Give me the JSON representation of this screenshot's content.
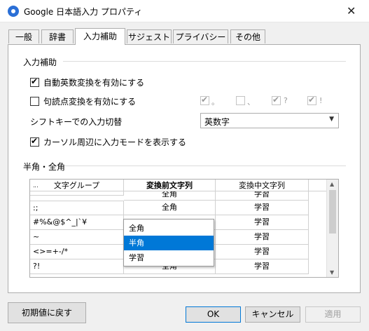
{
  "window": {
    "title": "Google 日本語入力 プロパティ",
    "close_glyph": "✕"
  },
  "tabs": [
    {
      "label": "一般"
    },
    {
      "label": "辞書"
    },
    {
      "label": "入力補助"
    },
    {
      "label": "サジェスト"
    },
    {
      "label": "プライバシー"
    },
    {
      "label": "その他"
    }
  ],
  "input_assist": {
    "section_title": "入力補助",
    "auto_alnum": {
      "label": "自動英数変換を有効にする",
      "checked": true
    },
    "punct_convert": {
      "label": "句読点変換を有効にする",
      "checked": false
    },
    "punct_chars": [
      {
        "label": "。",
        "checked": true
      },
      {
        "label": "、",
        "checked": false
      },
      {
        "label": "?",
        "checked": true
      },
      {
        "label": "!",
        "checked": true
      }
    ],
    "shift_toggle_label": "シフトキーでの入力切替",
    "shift_toggle_value": "英数字",
    "cursor_mode": {
      "label": "カーソル周辺に入力モードを表示する",
      "checked": true
    }
  },
  "half_full": {
    "section_title": "半角・全角",
    "columns": [
      "文字グループ",
      "変換前文字列",
      "変換中文字列"
    ],
    "rows": [
      {
        "group": "\"'",
        "before": "全角",
        "during": "学習"
      },
      {
        "group": ":;",
        "before": "全角",
        "during": "学習"
      },
      {
        "group": "#%&@$^_|`¥",
        "before": "",
        "during": "学習"
      },
      {
        "group": "~",
        "before": "",
        "during": "学習"
      },
      {
        "group": "<>=+-/*",
        "before": "",
        "during": "学習"
      },
      {
        "group": "?!",
        "before": "全角",
        "during": "学習"
      }
    ],
    "dropdown_options": [
      "全角",
      "半角",
      "学習"
    ],
    "dropdown_selected": "半角"
  },
  "buttons": {
    "reset": "初期値に戻す",
    "ok": "OK",
    "cancel": "キャンセル",
    "apply": "適用"
  }
}
